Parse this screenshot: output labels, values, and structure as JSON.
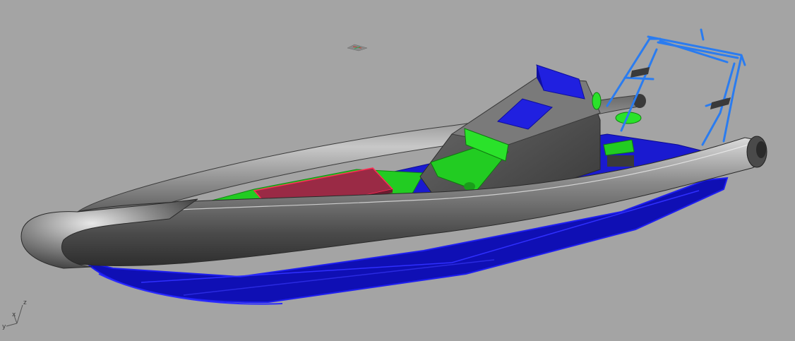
{
  "viewport": {
    "background": "#a4a4a4"
  },
  "axis_gizmo": {
    "x_label": "x",
    "y_label": "y",
    "z_label": "z"
  },
  "model": {
    "tube_color": "#5a5a5a",
    "hull_color": "#1414d8",
    "deck_color": "#22d822",
    "table_color": "#9a2a45",
    "console_color": "#5c5c5c",
    "frame_color": "#2a7cf0"
  }
}
